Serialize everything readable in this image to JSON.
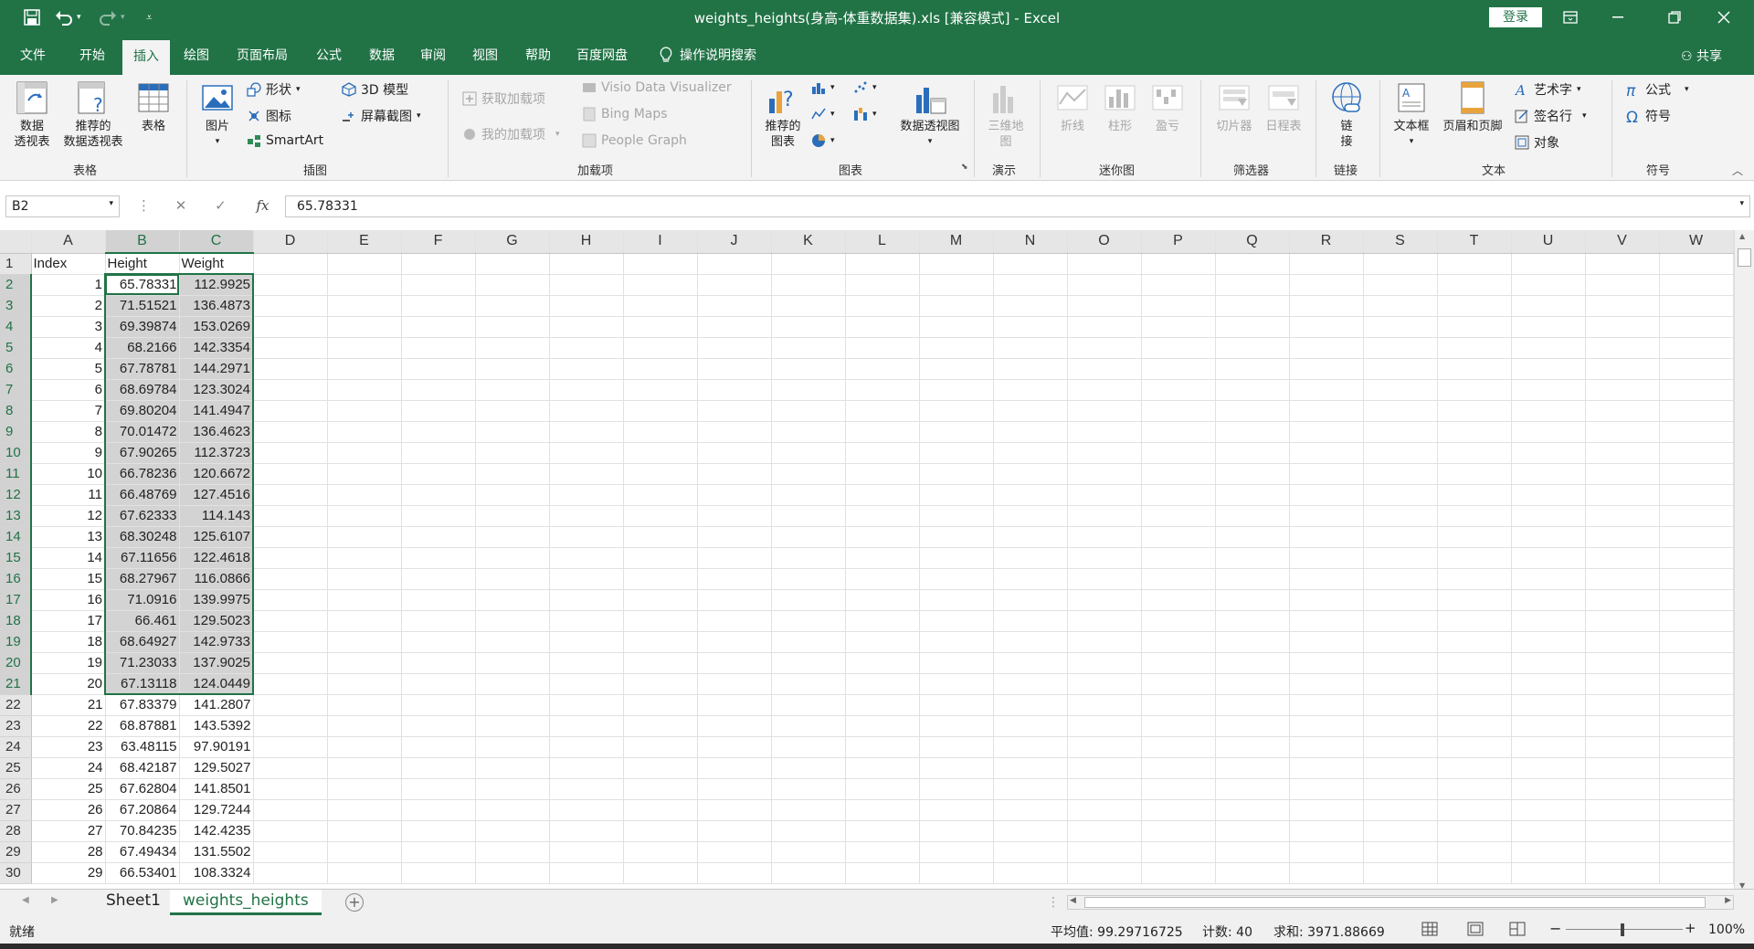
{
  "window": {
    "title": "weights_heights(身高-体重数据集).xls  [兼容模式]  -  Excel",
    "login_label": "登录",
    "accent": "#217346"
  },
  "tabs": [
    "文件",
    "开始",
    "插入",
    "绘图",
    "页面布局",
    "公式",
    "数据",
    "审阅",
    "视图",
    "帮助",
    "百度网盘"
  ],
  "active_tab": "插入",
  "tell_me": "操作说明搜索",
  "share": "共享",
  "ribbon": {
    "groups": {
      "tables": "表格",
      "illustrations": "插图",
      "addins": "加载项",
      "charts": "图表",
      "tours": "演示",
      "sparklines": "迷你图",
      "filters": "筛选器",
      "links": "链接",
      "text": "文本",
      "symbols": "符号"
    },
    "pivot_table": [
      "数据",
      "透视表"
    ],
    "recommended_pivot": [
      "推荐的",
      "数据透视表"
    ],
    "table": "表格",
    "picture": "图片",
    "shapes": "形状",
    "icons": "图标",
    "smartart": "SmartArt",
    "model3d": "3D 模型",
    "screenshot": "屏幕截图",
    "get_addins": "获取加载项",
    "my_addins": "我的加载项",
    "visio": "Visio Data Visualizer",
    "bing_maps": "Bing Maps",
    "people_graph": "People Graph",
    "recommended_charts": [
      "推荐的",
      "图表"
    ],
    "pivot_chart": "数据透视图",
    "map3d": [
      "三维地",
      "图"
    ],
    "spark_line": "折线",
    "spark_column": "柱形",
    "spark_winloss": "盈亏",
    "slicer": "切片器",
    "timeline": "日程表",
    "link": [
      "链",
      "接"
    ],
    "textbox": "文本框",
    "header_footer": "页眉和页脚",
    "wordart": "艺术字",
    "signature": "签名行",
    "object": "对象",
    "equation": "公式",
    "symbol": "符号"
  },
  "formula_bar": {
    "name_box": "B2",
    "fx": "fx",
    "value": "65.78331"
  },
  "columns": [
    "A",
    "B",
    "C",
    "D",
    "E",
    "F",
    "G",
    "H",
    "I",
    "J",
    "K",
    "L",
    "M",
    "N",
    "O",
    "P",
    "Q",
    "R",
    "S",
    "T",
    "U",
    "V",
    "W"
  ],
  "header_row": [
    "Index",
    "Height",
    "Weight"
  ],
  "rows": [
    [
      "1",
      "65.78331",
      "112.9925"
    ],
    [
      "2",
      "71.51521",
      "136.4873"
    ],
    [
      "3",
      "69.39874",
      "153.0269"
    ],
    [
      "4",
      "68.2166",
      "142.3354"
    ],
    [
      "5",
      "67.78781",
      "144.2971"
    ],
    [
      "6",
      "68.69784",
      "123.3024"
    ],
    [
      "7",
      "69.80204",
      "141.4947"
    ],
    [
      "8",
      "70.01472",
      "136.4623"
    ],
    [
      "9",
      "67.90265",
      "112.3723"
    ],
    [
      "10",
      "66.78236",
      "120.6672"
    ],
    [
      "11",
      "66.48769",
      "127.4516"
    ],
    [
      "12",
      "67.62333",
      "114.143"
    ],
    [
      "13",
      "68.30248",
      "125.6107"
    ],
    [
      "14",
      "67.11656",
      "122.4618"
    ],
    [
      "15",
      "68.27967",
      "116.0866"
    ],
    [
      "16",
      "71.0916",
      "139.9975"
    ],
    [
      "17",
      "66.461",
      "129.5023"
    ],
    [
      "18",
      "68.64927",
      "142.9733"
    ],
    [
      "19",
      "71.23033",
      "137.9025"
    ],
    [
      "20",
      "67.13118",
      "124.0449"
    ],
    [
      "21",
      "67.83379",
      "141.2807"
    ],
    [
      "22",
      "68.87881",
      "143.5392"
    ],
    [
      "23",
      "63.48115",
      "97.90191"
    ],
    [
      "24",
      "68.42187",
      "129.5027"
    ],
    [
      "25",
      "67.62804",
      "141.8501"
    ],
    [
      "26",
      "67.20864",
      "129.7244"
    ],
    [
      "27",
      "70.84235",
      "142.4235"
    ],
    [
      "28",
      "67.49434",
      "131.5502"
    ],
    [
      "29",
      "66.53401",
      "108.3324"
    ]
  ],
  "sheets": [
    "Sheet1",
    "weights_heights"
  ],
  "active_sheet": "weights_heights",
  "status": {
    "mode": "就绪",
    "average": "平均值: 99.29716725",
    "count": "计数: 40",
    "sum": "求和: 3971.88669",
    "zoom": "100%"
  }
}
